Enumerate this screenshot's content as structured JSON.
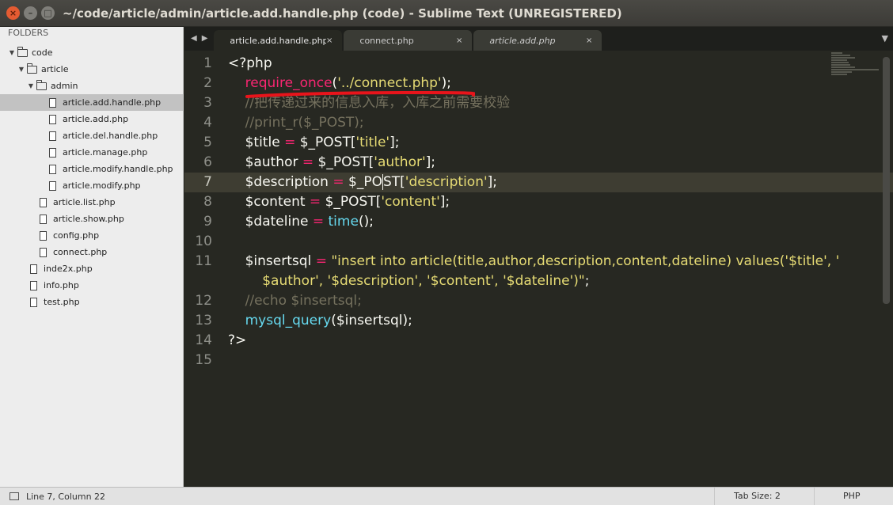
{
  "window": {
    "title": "~/code/article/admin/article.add.handle.php (code) - Sublime Text (UNREGISTERED)",
    "close_glyph": "×",
    "min_glyph": "–",
    "max_glyph": "□"
  },
  "sidebar": {
    "header": "FOLDERS",
    "items": [
      {
        "label": "code",
        "type": "folder",
        "depth": 0,
        "expanded": true
      },
      {
        "label": "article",
        "type": "folder",
        "depth": 1,
        "expanded": true
      },
      {
        "label": "admin",
        "type": "folder",
        "depth": 2,
        "expanded": true
      },
      {
        "label": "article.add.handle.php",
        "type": "file",
        "depth": 3,
        "selected": true
      },
      {
        "label": "article.add.php",
        "type": "file",
        "depth": 3
      },
      {
        "label": "article.del.handle.php",
        "type": "file",
        "depth": 3
      },
      {
        "label": "article.manage.php",
        "type": "file",
        "depth": 3
      },
      {
        "label": "article.modify.handle.php",
        "type": "file",
        "depth": 3
      },
      {
        "label": "article.modify.php",
        "type": "file",
        "depth": 3
      },
      {
        "label": "article.list.php",
        "type": "file",
        "depth": 2
      },
      {
        "label": "article.show.php",
        "type": "file",
        "depth": 2
      },
      {
        "label": "config.php",
        "type": "file",
        "depth": 2
      },
      {
        "label": "connect.php",
        "type": "file",
        "depth": 2
      },
      {
        "label": "inde2x.php",
        "type": "file",
        "depth": 1
      },
      {
        "label": "info.php",
        "type": "file",
        "depth": 1
      },
      {
        "label": "test.php",
        "type": "file",
        "depth": 1
      }
    ]
  },
  "tabs": {
    "nav_back": "◀",
    "nav_forward": "▶",
    "close_glyph": "×",
    "dropdown_glyph": "▼",
    "items": [
      {
        "label": "article.add.handle.php",
        "active": true,
        "italic": false
      },
      {
        "label": "connect.php",
        "active": false,
        "italic": false
      },
      {
        "label": "article.add.php",
        "active": false,
        "italic": true
      }
    ]
  },
  "editor": {
    "current_line": 7,
    "lines": [
      {
        "n": "1",
        "tokens": [
          {
            "t": "<?php",
            "c": "var"
          }
        ]
      },
      {
        "n": "2",
        "tokens": [
          {
            "t": "    ",
            "c": "var"
          },
          {
            "t": "require_once",
            "c": "kw"
          },
          {
            "t": "(",
            "c": "var"
          },
          {
            "t": "'../connect.php'",
            "c": "str"
          },
          {
            "t": ");",
            "c": "var"
          }
        ]
      },
      {
        "n": "3",
        "tokens": [
          {
            "t": "    //把传递过来的信息入库，入库之前需要校验",
            "c": "cmt"
          }
        ]
      },
      {
        "n": "4",
        "tokens": [
          {
            "t": "    //print_r($_POST);",
            "c": "cmt"
          }
        ]
      },
      {
        "n": "5",
        "tokens": [
          {
            "t": "    $title ",
            "c": "var"
          },
          {
            "t": "=",
            "c": "kw"
          },
          {
            "t": " $_POST[",
            "c": "var"
          },
          {
            "t": "'title'",
            "c": "str"
          },
          {
            "t": "];",
            "c": "var"
          }
        ]
      },
      {
        "n": "6",
        "tokens": [
          {
            "t": "    $author ",
            "c": "var"
          },
          {
            "t": "=",
            "c": "kw"
          },
          {
            "t": " $_POST[",
            "c": "var"
          },
          {
            "t": "'author'",
            "c": "str"
          },
          {
            "t": "];",
            "c": "var"
          }
        ]
      },
      {
        "n": "7",
        "tokens": [
          {
            "t": "    $description ",
            "c": "var"
          },
          {
            "t": "=",
            "c": "kw"
          },
          {
            "t": " $_PO",
            "c": "var"
          },
          {
            "t": "",
            "c": "cursor"
          },
          {
            "t": "ST[",
            "c": "var"
          },
          {
            "t": "'description'",
            "c": "str"
          },
          {
            "t": "];",
            "c": "var"
          }
        ]
      },
      {
        "n": "8",
        "tokens": [
          {
            "t": "    $content ",
            "c": "var"
          },
          {
            "t": "=",
            "c": "kw"
          },
          {
            "t": " $_POST[",
            "c": "var"
          },
          {
            "t": "'content'",
            "c": "str"
          },
          {
            "t": "];",
            "c": "var"
          }
        ]
      },
      {
        "n": "9",
        "tokens": [
          {
            "t": "    $dateline ",
            "c": "var"
          },
          {
            "t": "=",
            "c": "kw"
          },
          {
            "t": " ",
            "c": "var"
          },
          {
            "t": "time",
            "c": "fn"
          },
          {
            "t": "();",
            "c": "var"
          }
        ]
      },
      {
        "n": "10",
        "tokens": []
      },
      {
        "n": "11",
        "tokens": [
          {
            "t": "    $insertsql ",
            "c": "var"
          },
          {
            "t": "=",
            "c": "kw"
          },
          {
            "t": " ",
            "c": "var"
          },
          {
            "t": "\"insert into article(title,author,description,content,dateline) values('$title', '",
            "c": "str"
          }
        ]
      },
      {
        "n": "",
        "tokens": [
          {
            "t": "        $author', '$description', '$content', '$dateline')\"",
            "c": "str"
          },
          {
            "t": ";",
            "c": "var"
          }
        ]
      },
      {
        "n": "12",
        "tokens": [
          {
            "t": "    //echo $insertsql;",
            "c": "cmt"
          }
        ]
      },
      {
        "n": "13",
        "tokens": [
          {
            "t": "    ",
            "c": "var"
          },
          {
            "t": "mysql_query",
            "c": "fn"
          },
          {
            "t": "($insertsql);",
            "c": "var"
          }
        ]
      },
      {
        "n": "14",
        "tokens": [
          {
            "t": "?>",
            "c": "var"
          }
        ]
      },
      {
        "n": "15",
        "tokens": []
      }
    ]
  },
  "statusbar": {
    "position": "Line 7, Column 22",
    "tab_size": "Tab Size: 2",
    "syntax": "PHP"
  },
  "colors": {
    "background": "#272822",
    "keyword": "#f92672",
    "string": "#e6db74",
    "comment": "#75715e",
    "function": "#66d9ef",
    "annotation_underline": "#e8141b"
  }
}
